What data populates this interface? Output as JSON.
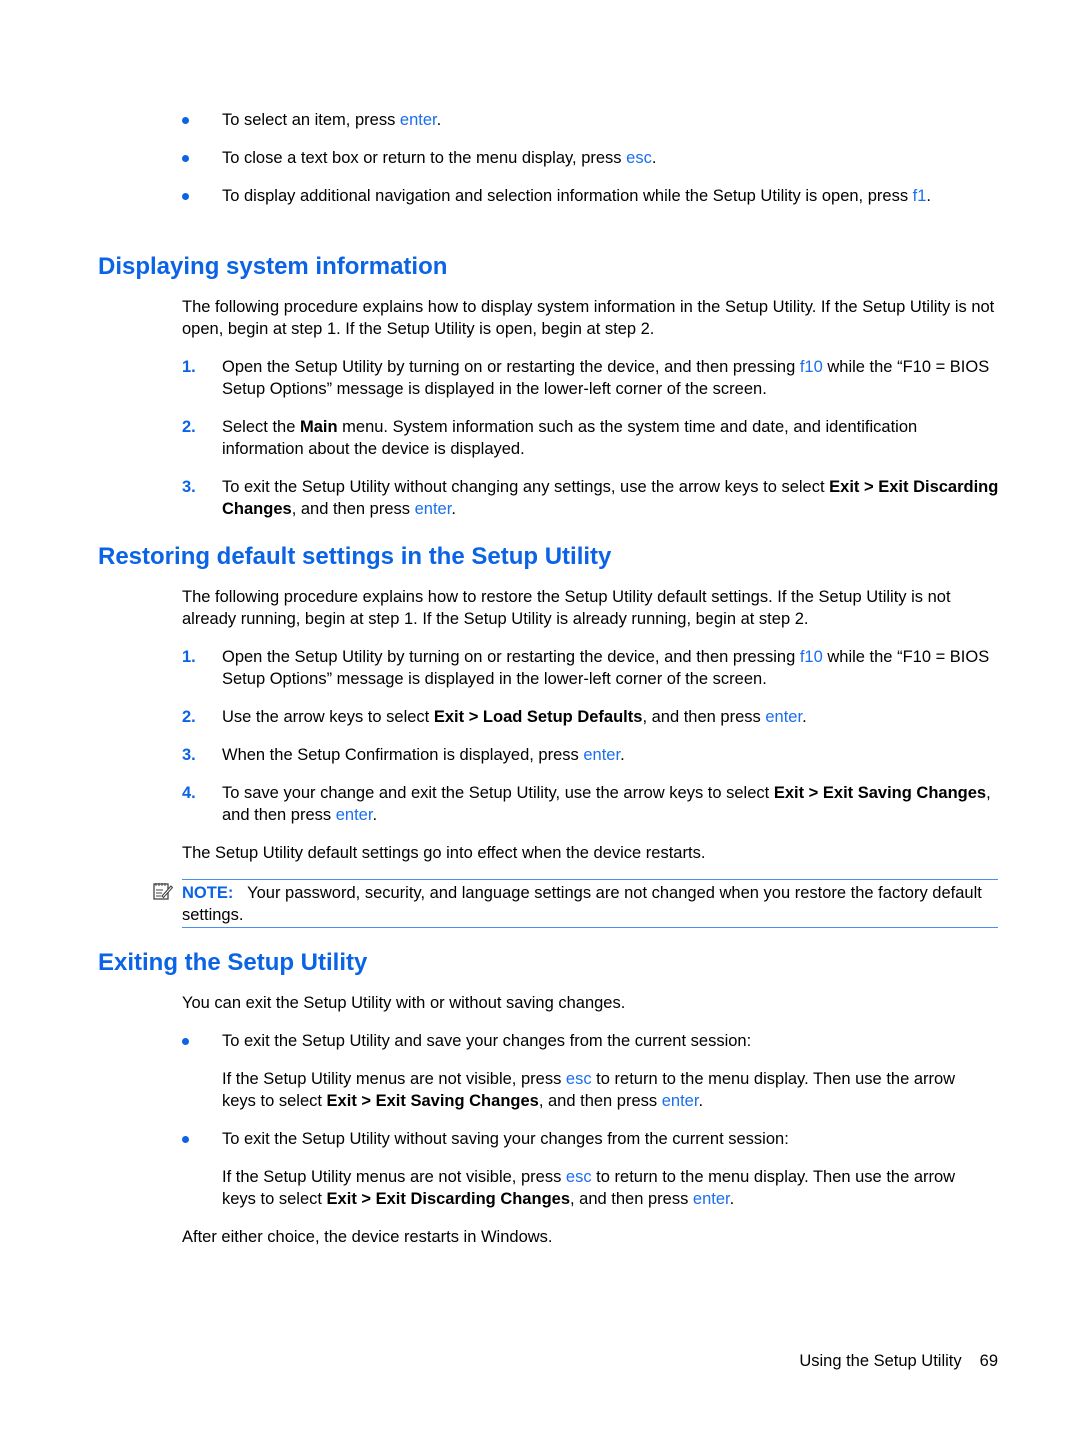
{
  "top_bullets": [
    {
      "pre": "To select an item, press ",
      "key": "enter",
      "post": "."
    },
    {
      "pre": "To close a text box or return to the menu display, press ",
      "key": "esc",
      "post": "."
    },
    {
      "pre": "To display additional navigation and selection information while the Setup Utility is open, press ",
      "key": "f1",
      "post": "."
    }
  ],
  "sec1": {
    "title": "Displaying system information",
    "intro": "The following procedure explains how to display system information in the Setup Utility. If the Setup Utility is not open, begin at step 1. If the Setup Utility is open, begin at step 2.",
    "steps": [
      {
        "num": "1.",
        "a": "Open the Setup Utility by turning on or restarting the device, and then pressing ",
        "key": "f10",
        "b": " while the “F10 = BIOS Setup Options” message is displayed in the lower-left corner of the screen."
      },
      {
        "num": "2.",
        "a": "Select the ",
        "bold": "Main",
        "b": " menu. System information such as the system time and date, and identification information about the device is displayed."
      },
      {
        "num": "3.",
        "a": "To exit the Setup Utility without changing any settings, use the arrow keys to select ",
        "bold": "Exit > Exit Discarding Changes",
        "b": ", and then press ",
        "key": "enter",
        "c": "."
      }
    ]
  },
  "sec2": {
    "title": "Restoring default settings in the Setup Utility",
    "intro": "The following procedure explains how to restore the Setup Utility default settings. If the Setup Utility is not already running, begin at step 1. If the Setup Utility is already running, begin at step 2.",
    "steps": [
      {
        "num": "1.",
        "a": "Open the Setup Utility by turning on or restarting the device, and then pressing ",
        "key": "f10",
        "b": " while the “F10 = BIOS Setup Options” message is displayed in the lower-left corner of the screen."
      },
      {
        "num": "2.",
        "a": "Use the arrow keys to select ",
        "bold": "Exit > Load Setup Defaults",
        "b": ", and then press ",
        "key": "enter",
        "c": "."
      },
      {
        "num": "3.",
        "a": "When the Setup Confirmation is displayed, press ",
        "key": "enter",
        "b": "."
      },
      {
        "num": "4.",
        "a": "To save your change and exit the Setup Utility, use the arrow keys to select ",
        "bold": "Exit > Exit Saving Changes",
        "b": ", and then press ",
        "key": "enter",
        "c": "."
      }
    ],
    "outro": "The Setup Utility default settings go into effect when the device restarts.",
    "note_label": "NOTE:",
    "note_text": "Your password, security, and language settings are not changed when you restore the factory default settings."
  },
  "sec3": {
    "title": "Exiting the Setup Utility",
    "intro": "You can exit the Setup Utility with or without saving changes.",
    "bullets": [
      {
        "text": "To exit the Setup Utility and save your changes from the current session:",
        "sub_a": "If the Setup Utility menus are not visible, press ",
        "sub_key1": "esc",
        "sub_b": " to return to the menu display. Then use the arrow keys to select ",
        "sub_bold": "Exit > Exit Saving Changes",
        "sub_c": ", and then press ",
        "sub_key2": "enter",
        "sub_d": "."
      },
      {
        "text": "To exit the Setup Utility without saving your changes from the current session:",
        "sub_a": "If the Setup Utility menus are not visible, press ",
        "sub_key1": "esc",
        "sub_b": " to return to the menu display. Then use the arrow keys to select ",
        "sub_bold": "Exit > Exit Discarding Changes",
        "sub_c": ", and then press ",
        "sub_key2": "enter",
        "sub_d": "."
      }
    ],
    "outro": "After either choice, the device restarts in Windows."
  },
  "footer": {
    "title": "Using the Setup Utility",
    "page": "69"
  }
}
